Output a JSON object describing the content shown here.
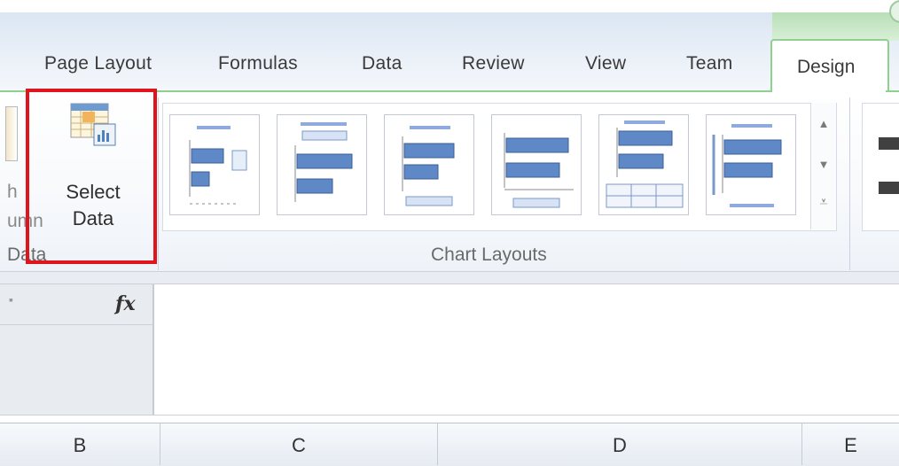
{
  "tabs": {
    "page_layout": "Page Layout",
    "formulas": "Formulas",
    "data": "Data",
    "review": "Review",
    "view": "View",
    "team": "Team",
    "design": "Design"
  },
  "ribbon": {
    "partial_left_top": "h",
    "partial_left_bottom": "umn",
    "select_data_line1": "Select",
    "select_data_line2": "Data",
    "data_group_label": "Data",
    "chart_layouts_label": "Chart Layouts"
  },
  "formula_bar": {
    "fx_label": "fx"
  },
  "columns": [
    "B",
    "C",
    "D",
    "E"
  ],
  "colors": {
    "highlight": "#e0141c",
    "design_tab_border": "#8fd08f",
    "chart_blue": "#4f81bd"
  },
  "icons": [
    "select-data-icon",
    "scroll-up-icon",
    "scroll-down-icon",
    "gallery-more-icon"
  ]
}
